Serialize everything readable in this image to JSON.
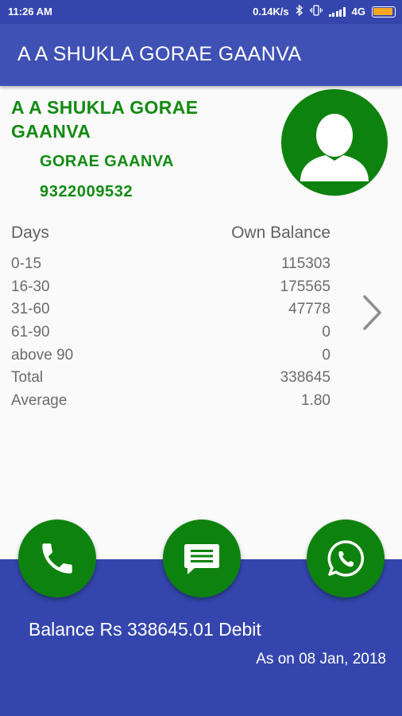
{
  "status_bar": {
    "time": "11:26 AM",
    "network_speed": "0.14K/s",
    "network_type": "4G",
    "icons": [
      "bluetooth-icon",
      "vibrate-icon",
      "signal-icon",
      "battery-icon"
    ]
  },
  "app_bar": {
    "title": "A A SHUKLA GORAE GAANVA"
  },
  "customer": {
    "name": "A A SHUKLA GORAE GAANVA",
    "city": "GORAE GAANVA",
    "phone": "9322009532",
    "avatar_icon": "person-icon"
  },
  "aging_table": {
    "headers": {
      "days": "Days",
      "balance": "Own Balance"
    },
    "rows": [
      {
        "label": "0-15",
        "value": "115303"
      },
      {
        "label": "16-30",
        "value": "175565"
      },
      {
        "label": "31-60",
        "value": "47778"
      },
      {
        "label": "61-90",
        "value": "0"
      },
      {
        "label": "above 90",
        "value": "0"
      },
      {
        "label": "Total",
        "value": "338645"
      },
      {
        "label": "Average",
        "value": "1.80"
      }
    ]
  },
  "actions": {
    "call_icon": "phone-icon",
    "sms_icon": "message-icon",
    "whatsapp_icon": "whatsapp-icon",
    "next_icon": "chevron-right-icon"
  },
  "footer": {
    "balance_text": "Balance Rs 338645.01 Debit",
    "as_on_text": "As on 08 Jan, 2018"
  },
  "colors": {
    "primary": "#3f51b5",
    "primary_dark": "#3446ad",
    "green": "#0e820e",
    "text_green": "#138a13"
  }
}
